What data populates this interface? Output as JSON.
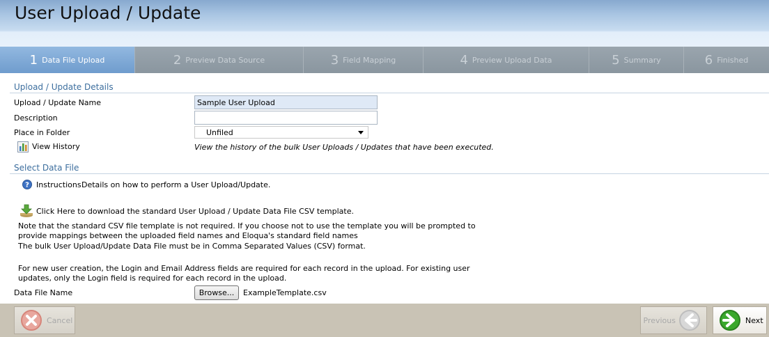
{
  "page_title": "User Upload / Update",
  "steps": [
    {
      "num": "1",
      "label": "Data File Upload",
      "active": true
    },
    {
      "num": "2",
      "label": "Preview Data Source",
      "active": false
    },
    {
      "num": "3",
      "label": "Field Mapping",
      "active": false
    },
    {
      "num": "4",
      "label": "Preview Upload Data",
      "active": false
    },
    {
      "num": "5",
      "label": "Summary",
      "active": false
    },
    {
      "num": "6",
      "label": "Finished",
      "active": false
    }
  ],
  "details": {
    "section_title": "Upload / Update Details",
    "name_label": "Upload / Update Name",
    "name_value": "Sample User Upload",
    "description_label": "Description",
    "description_value": "",
    "folder_label": "Place in Folder",
    "folder_value": "Unfiled",
    "history_link": "View History",
    "history_description": "View the history of the bulk User Uploads / Updates that have been executed."
  },
  "data_file": {
    "section_title": "Select Data File",
    "instructions_link": "Instructions",
    "instructions_text": "Details on how to perform a User Upload/Update.",
    "download_link": "Click Here to download the standard User Upload / Update Data File CSV template.",
    "note_line1": "Note that the standard CSV file template is not required. If you choose not to use the template you will be prompted to",
    "note_line2": "provide mappings between the uploaded field names and Eloqua's standard field names",
    "format_note": "The bulk User Upload/Update Data File must be in Comma Separated Values (CSV) format.",
    "requirement_line1": "For new user creation, the Login and Email Address fields are required for each record in the upload. For existing user",
    "requirement_line2": "updates, only the Login field is required for each record in the upload.",
    "file_label": "Data File Name",
    "browse_label": "Browse...",
    "file_value": "ExampleTemplate.csv"
  },
  "footer": {
    "cancel_label": "Cancel",
    "previous_label": "Previous",
    "next_label": "Next"
  },
  "colors": {
    "accent": "#6f9ccd",
    "section_title": "#3c6e9e",
    "next_green": "#2f9a23",
    "cancel_red": "#d44a3a"
  }
}
